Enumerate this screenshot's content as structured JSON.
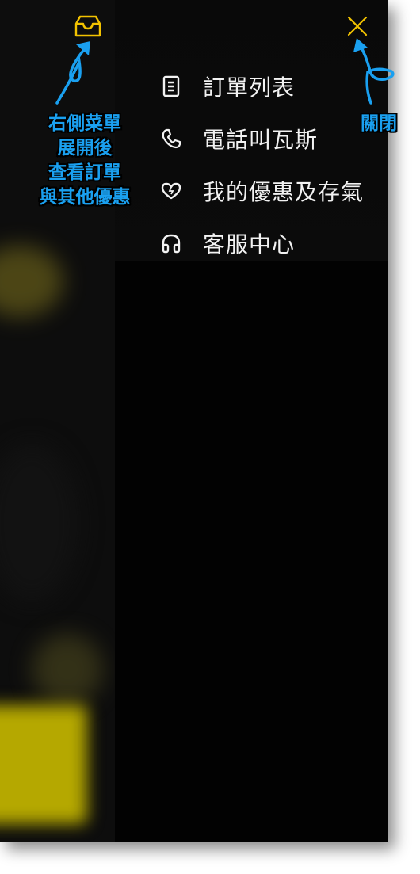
{
  "header": {
    "inbox_icon": "inbox-icon",
    "close_icon": "close-icon",
    "accent_color": "#f2c200"
  },
  "menu": {
    "items": [
      {
        "icon": "list-icon",
        "label": "訂單列表"
      },
      {
        "icon": "phone-icon",
        "label": "電話叫瓦斯"
      },
      {
        "icon": "heart-icon",
        "label": "我的優惠及存氣"
      },
      {
        "icon": "headphones-icon",
        "label": "客服中心"
      }
    ]
  },
  "annotations": {
    "left_lines": [
      "右側菜單",
      "展開後",
      "查看訂單",
      "與其他優惠"
    ],
    "right_text": "關閉",
    "color": "#1aa0f0"
  }
}
